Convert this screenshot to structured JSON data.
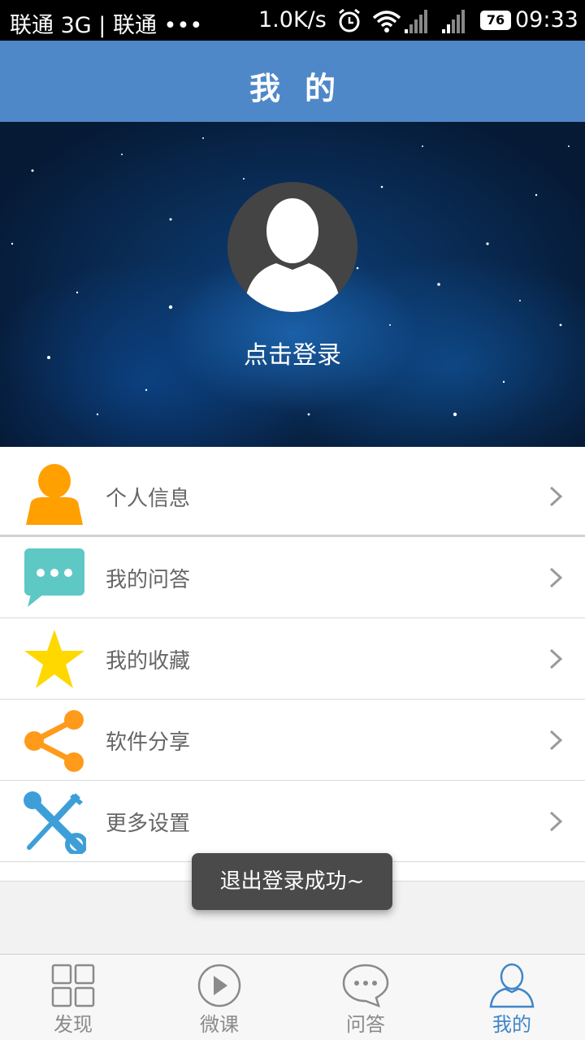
{
  "status_bar": {
    "carrier_text": "联通 3G | 联通 •••",
    "speed": "1.0K/s",
    "battery": "76",
    "time": "09:33"
  },
  "header": {
    "title": "我的"
  },
  "profile": {
    "login_prompt": "点击登录"
  },
  "menu": {
    "items": [
      {
        "label": "个人信息",
        "icon": "person-icon",
        "color": "#ff9f00"
      },
      {
        "label": "我的问答",
        "icon": "chat-bubble-icon",
        "color": "#5ec8c4"
      },
      {
        "label": "我的收藏",
        "icon": "star-icon",
        "color": "#ffd800"
      },
      {
        "label": "软件分享",
        "icon": "share-icon",
        "color": "#ff9a1a"
      },
      {
        "label": "更多设置",
        "icon": "tools-icon",
        "color": "#3e9fd8"
      }
    ]
  },
  "toast": {
    "message": "退出登录成功~"
  },
  "bottom_nav": {
    "active_index": 3,
    "items": [
      {
        "label": "发现",
        "icon": "grid-icon"
      },
      {
        "label": "微课",
        "icon": "play-icon"
      },
      {
        "label": "问答",
        "icon": "chat-icon"
      },
      {
        "label": "我的",
        "icon": "user-icon"
      }
    ]
  },
  "colors": {
    "header": "#4f88c9",
    "active_nav": "#3f86c8",
    "inactive_nav": "#8a8a8a"
  }
}
